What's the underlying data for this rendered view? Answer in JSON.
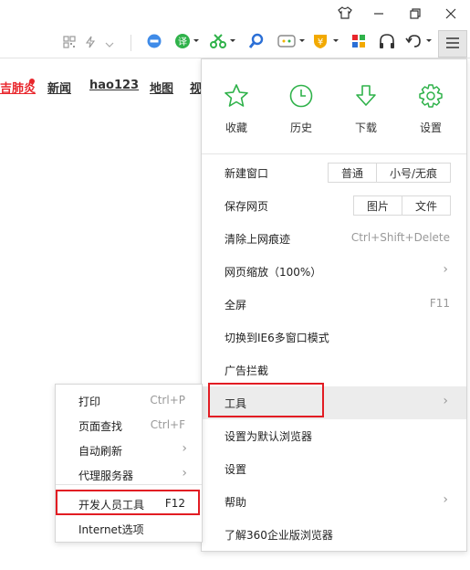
{
  "nav": {
    "items": [
      {
        "label": "吉肺炎"
      },
      {
        "label": "新闻"
      },
      {
        "label": "hao123"
      },
      {
        "label": "地图"
      },
      {
        "label": "视"
      }
    ]
  },
  "menu": {
    "quick": [
      {
        "label": "收藏",
        "icon": "star-icon"
      },
      {
        "label": "历史",
        "icon": "clock-icon"
      },
      {
        "label": "下载",
        "icon": "download-icon"
      },
      {
        "label": "设置",
        "icon": "gear-icon"
      }
    ],
    "new_window": {
      "label": "新建窗口",
      "opt1": "普通",
      "opt2": "小号/无痕"
    },
    "save_page": {
      "label": "保存网页",
      "opt1": "图片",
      "opt2": "文件"
    },
    "clear_history": {
      "label": "清除上网痕迹",
      "shortcut": "Ctrl+Shift+Delete"
    },
    "zoom": {
      "label": "网页缩放（100%）"
    },
    "fullscreen": {
      "label": "全屏",
      "shortcut": "F11"
    },
    "ie6_mode": {
      "label": "切换到IE6多窗口模式"
    },
    "adblock": {
      "label": "广告拦截"
    },
    "tools": {
      "label": "工具"
    },
    "set_default": {
      "label": "设置为默认浏览器"
    },
    "settings": {
      "label": "设置"
    },
    "help": {
      "label": "帮助"
    },
    "about_enterprise": {
      "label": "了解360企业版浏览器"
    }
  },
  "submenu": {
    "print": {
      "label": "打印",
      "shortcut": "Ctrl+P"
    },
    "find": {
      "label": "页面查找",
      "shortcut": "Ctrl+F"
    },
    "auto_refresh": {
      "label": "自动刷新"
    },
    "proxy": {
      "label": "代理服务器"
    },
    "devtools": {
      "label": "开发人员工具",
      "shortcut": "F12"
    },
    "internet_options": {
      "label": "Internet选项"
    }
  },
  "colors": {
    "accent_green": "#2fb24a",
    "highlight_red": "#e21c23",
    "hot_red": "#e8262c"
  }
}
